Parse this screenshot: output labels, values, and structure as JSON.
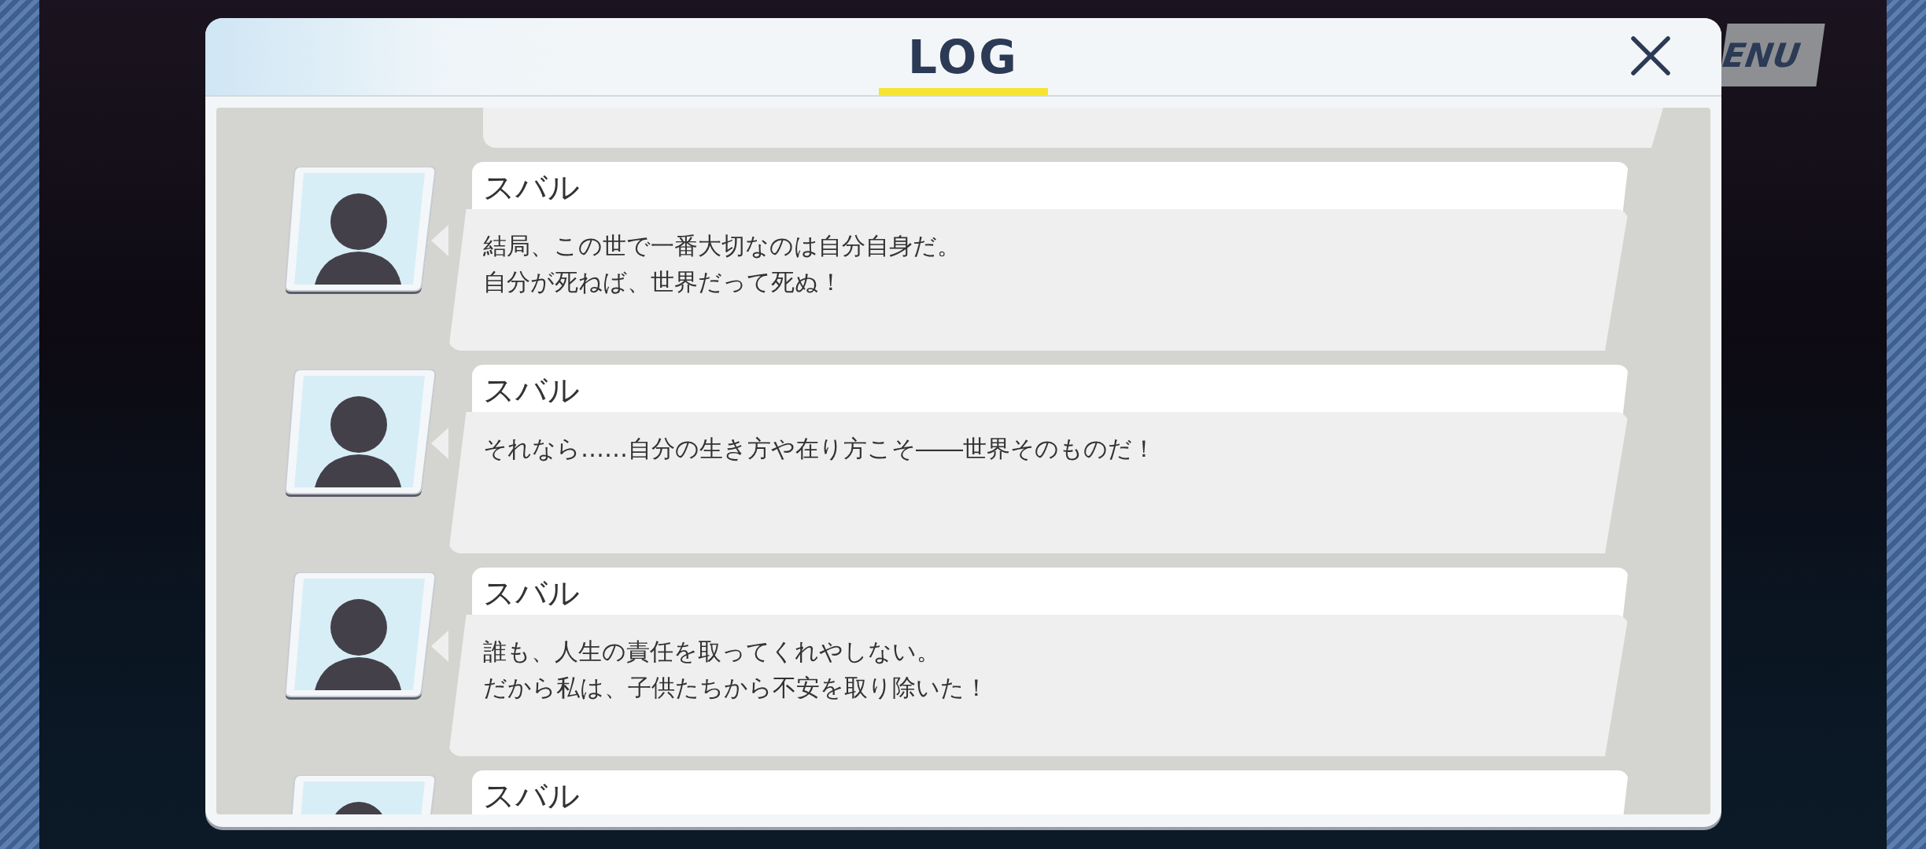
{
  "menu_button": {
    "label": "ENU"
  },
  "log_panel": {
    "title": "LOG",
    "entries": [
      {
        "speaker": "スバル",
        "lines": [
          "結局、この世で一番大切なのは自分自身だ。",
          "自分が死ねば、世界だって死ぬ！"
        ]
      },
      {
        "speaker": "スバル",
        "lines": [
          "それなら……自分の生き方や在り方こそ――世界そのものだ！"
        ]
      },
      {
        "speaker": "スバル",
        "lines": [
          "誰も、人生の責任を取ってくれやしない。",
          "だから私は、子供たちから不安を取り除いた！"
        ]
      },
      {
        "speaker": "スバル"
      }
    ]
  }
}
